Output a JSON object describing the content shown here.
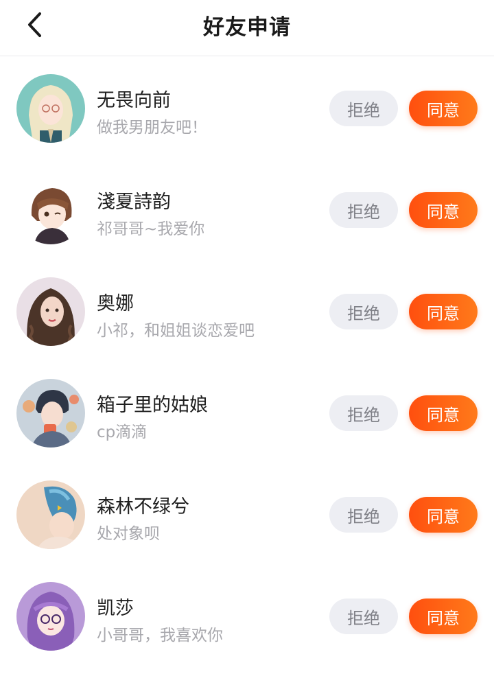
{
  "header": {
    "title": "好友申请",
    "back_icon": "chevron-left-icon"
  },
  "buttons": {
    "reject_label": "拒绝",
    "accept_label": "同意"
  },
  "colors": {
    "accent": "#ff5a14",
    "reject_bg": "#edeef3",
    "subtext": "#a8a8ad"
  },
  "requests": [
    {
      "name": "无畏向前",
      "message": "做我男朋友吧！"
    },
    {
      "name": "淺夏詩韵",
      "message": "祁哥哥~我爱你"
    },
    {
      "name": "奥娜",
      "message": "小祁，和姐姐谈恋爱吧"
    },
    {
      "name": "箱子里的姑娘",
      "message": "cp滴滴"
    },
    {
      "name": "森林不绿兮",
      "message": "处对象呗"
    },
    {
      "name": "凯莎",
      "message": "小哥哥，我喜欢你"
    }
  ]
}
